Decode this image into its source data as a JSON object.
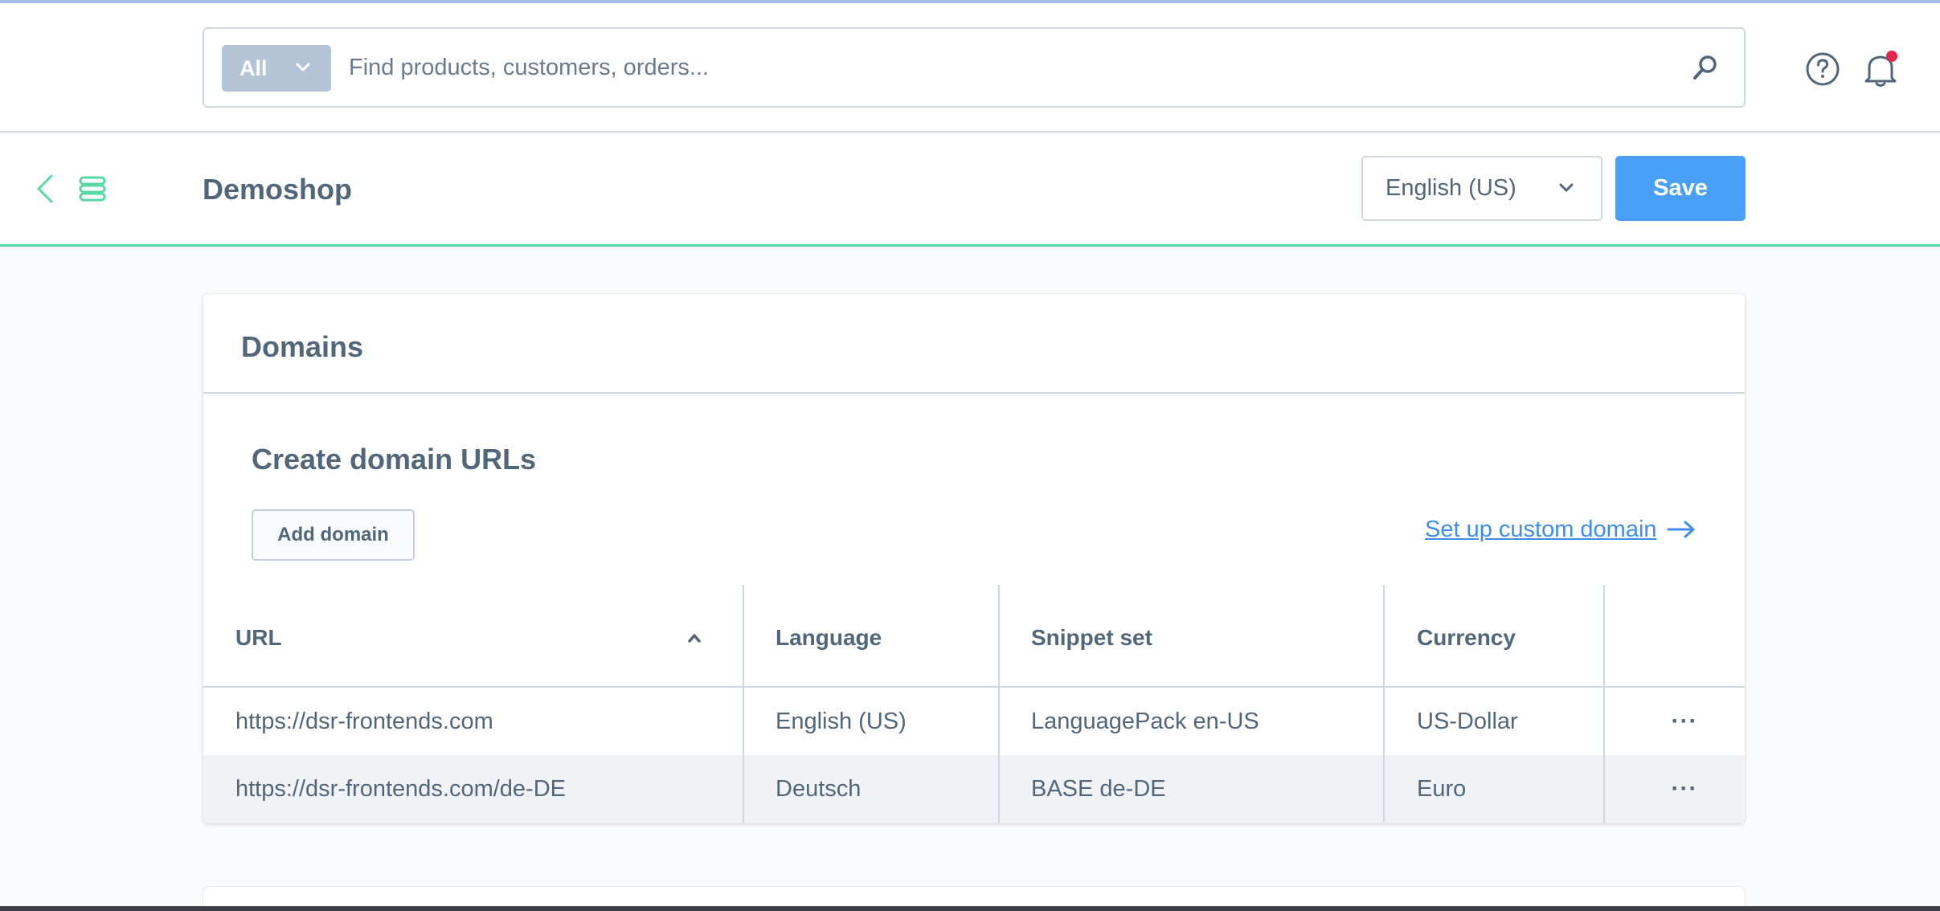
{
  "search": {
    "type_label": "All",
    "placeholder": "Find products, customers, orders..."
  },
  "header": {
    "title": "Demoshop",
    "language": "English (US)",
    "save_label": "Save"
  },
  "card": {
    "title": "Domains",
    "section_title": "Create domain URLs",
    "add_domain_label": "Add domain",
    "custom_domain_link": "Set up custom domain"
  },
  "table": {
    "columns": [
      "URL",
      "Language",
      "Snippet set",
      "Currency"
    ],
    "rows": [
      {
        "url": "https://dsr-frontends.com",
        "language": "English (US)",
        "snippet_set": "LanguagePack en-US",
        "currency": "US-Dollar",
        "actions": "···"
      },
      {
        "url": "https://dsr-frontends.com/de-DE",
        "language": "Deutsch",
        "snippet_set": "BASE de-DE",
        "currency": "Euro",
        "actions": "···"
      }
    ]
  },
  "colors": {
    "accent": "#4aa0f7",
    "highlight_line": "#57d9a3",
    "notification_dot": "#de294c"
  }
}
